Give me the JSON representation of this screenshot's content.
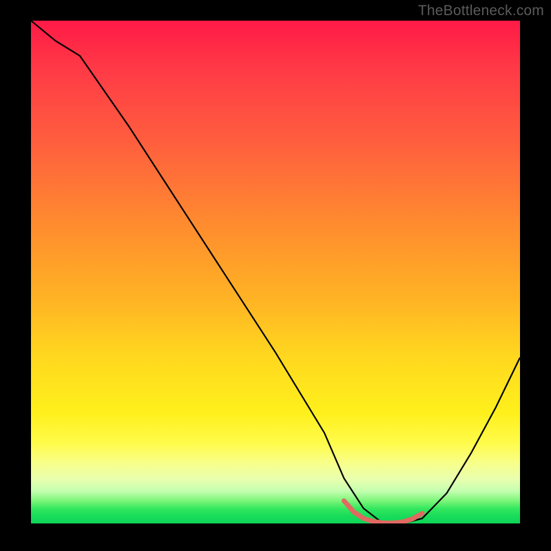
{
  "watermark": "TheBottleneck.com",
  "chart_data": {
    "type": "line",
    "title": "",
    "xlabel": "",
    "ylabel": "",
    "xlim": [
      0,
      100
    ],
    "ylim": [
      0,
      100
    ],
    "grid": false,
    "legend": false,
    "series": [
      {
        "name": "bottleneck-curve",
        "x": [
          0,
          5,
          10,
          20,
          30,
          40,
          50,
          60,
          64,
          68,
          72,
          76,
          80,
          85,
          90,
          95,
          100
        ],
        "values": [
          100,
          96,
          93,
          79,
          64,
          49,
          34,
          18,
          9,
          3,
          0,
          0,
          1,
          6,
          14,
          23,
          33
        ]
      }
    ],
    "overlay_segment": {
      "name": "optimal-range",
      "x": [
        64,
        66,
        68,
        70,
        72,
        74,
        76,
        78,
        80
      ],
      "values": [
        4.5,
        2.3,
        1.0,
        0.4,
        0.1,
        0.1,
        0.3,
        0.9,
        2.0
      ],
      "color": "#e06a61"
    },
    "colors": {
      "curve": "#000000",
      "overlay": "#e06a61",
      "frame": "#000000"
    }
  }
}
